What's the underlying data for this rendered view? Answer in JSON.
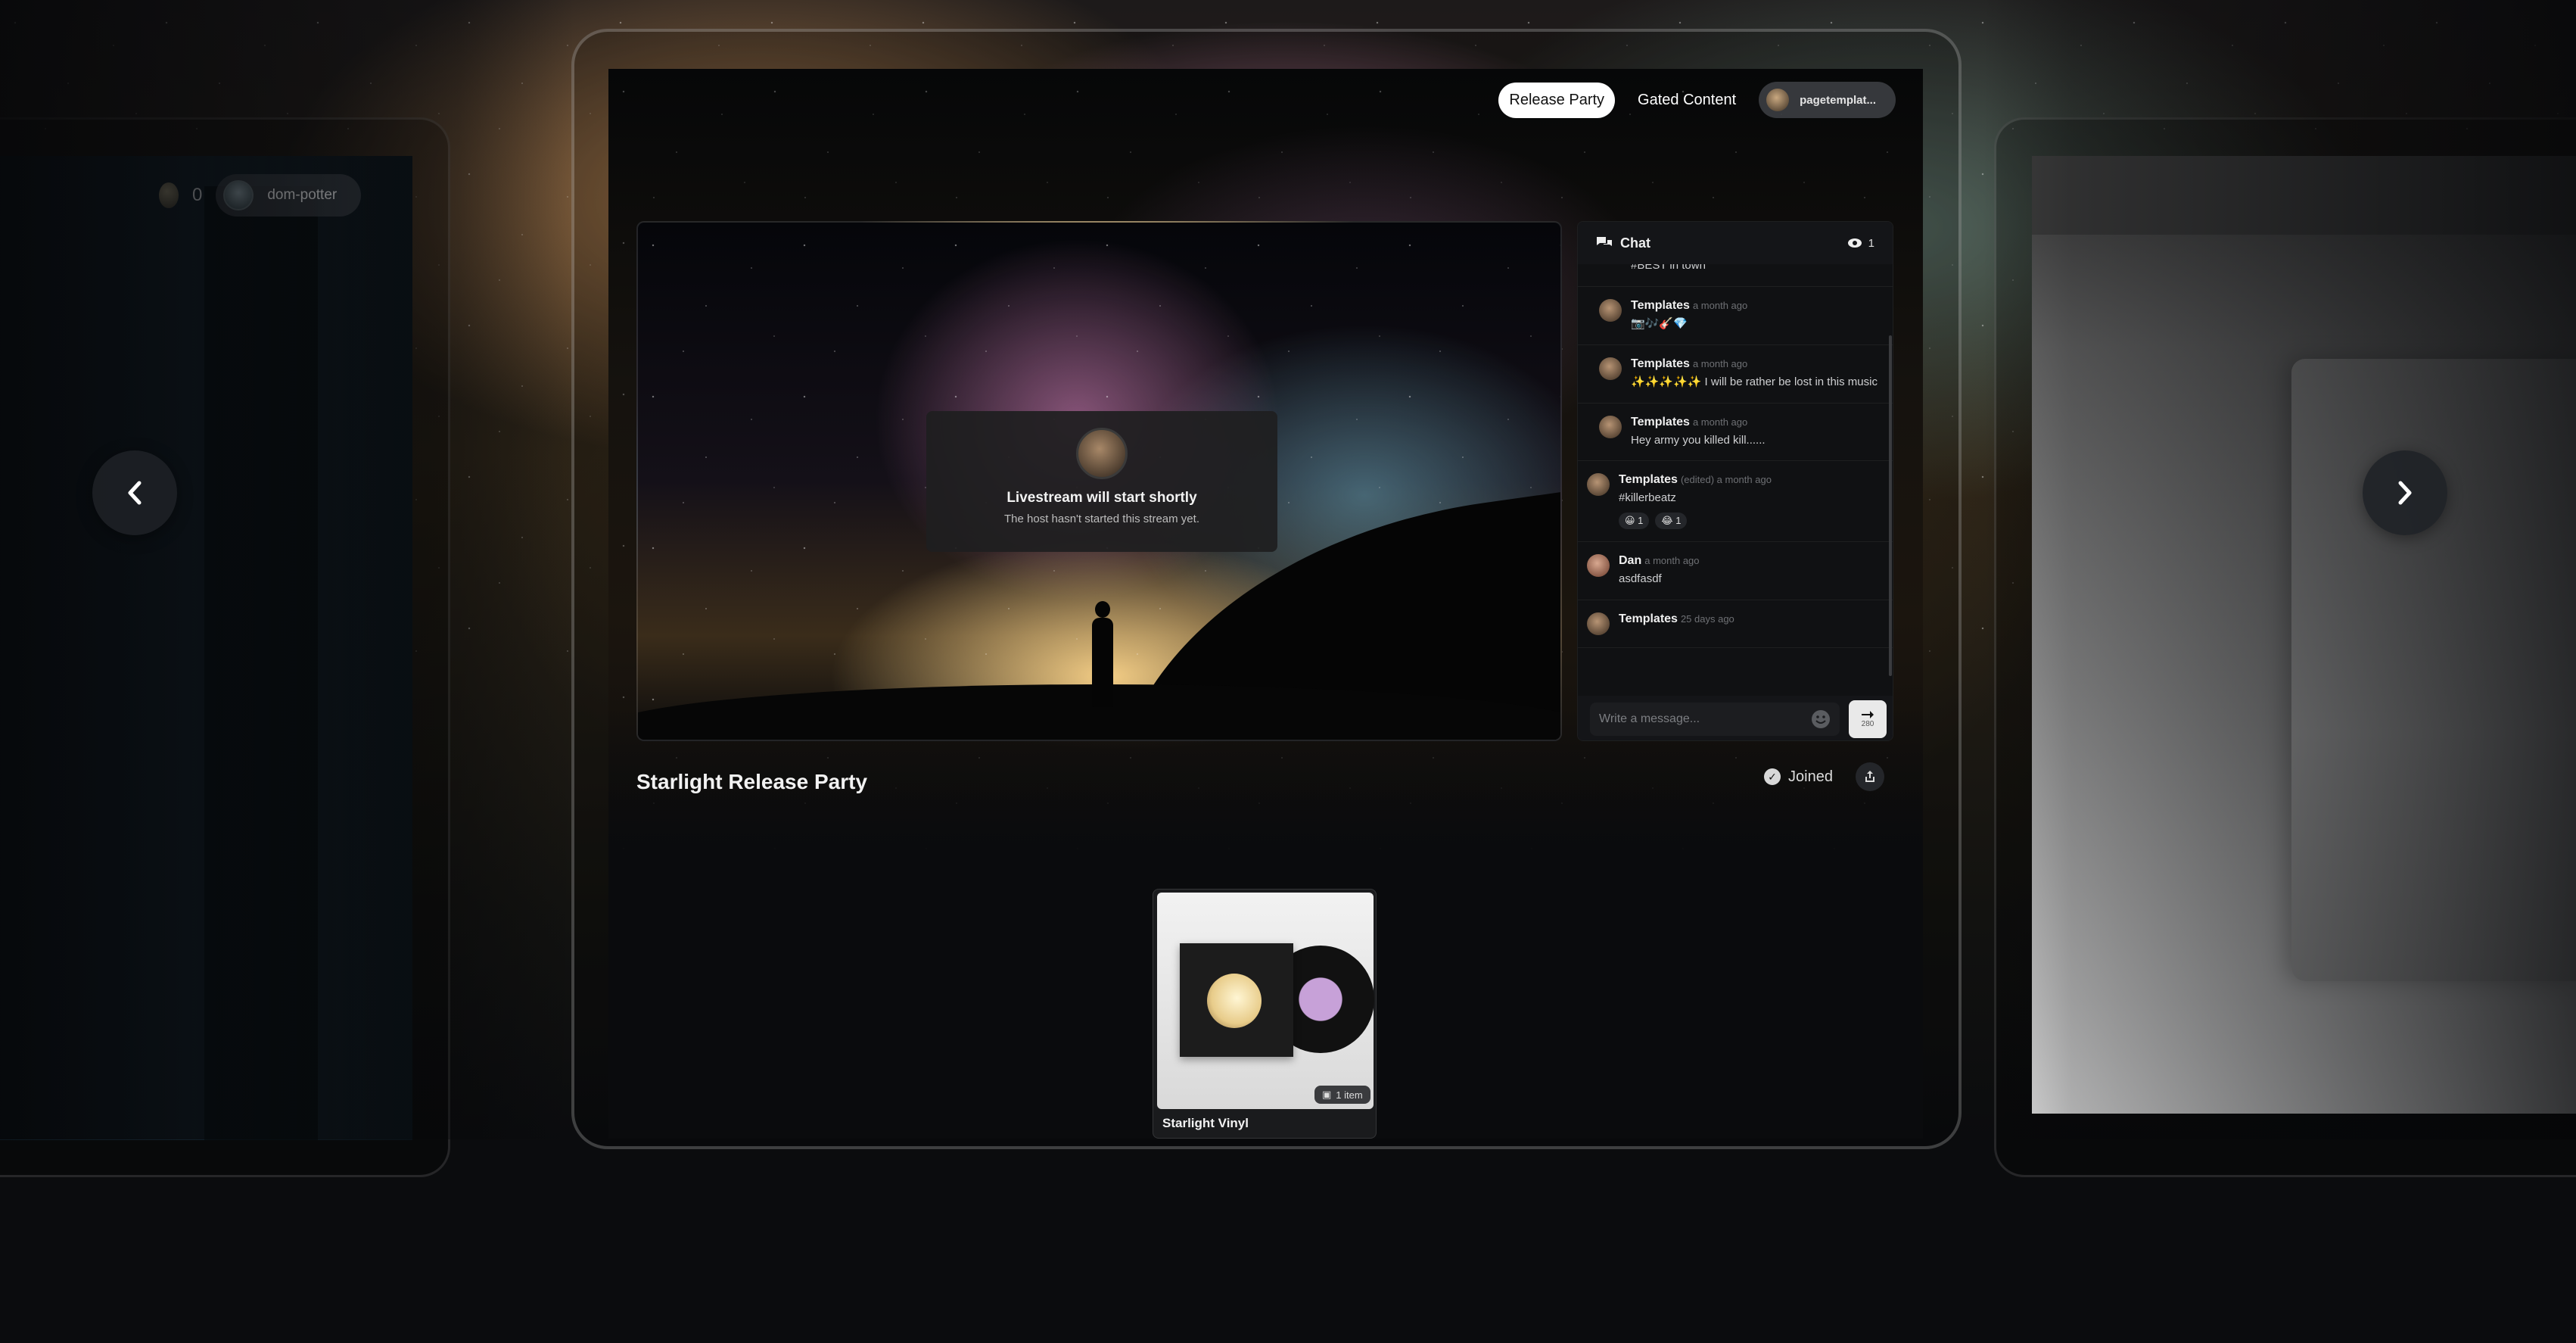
{
  "left_preview": {
    "coin_count": "0",
    "username": "dom-potter"
  },
  "nav": {
    "prev_icon": "chevron-left-icon",
    "next_icon": "chevron-right-icon"
  },
  "topnav": {
    "tabs": [
      {
        "label": "Release Party",
        "active": true
      },
      {
        "label": "Gated Content",
        "active": false
      }
    ],
    "account": "pagetemplat..."
  },
  "stream": {
    "title": "Livestream will start shortly",
    "subtitle": "The host hasn't started this stream yet."
  },
  "chat": {
    "title": "Chat",
    "viewer_count": "1",
    "messages": [
      {
        "author": "",
        "time": "",
        "text": "#BEST in town"
      },
      {
        "author": "Templates",
        "time": "a month ago",
        "text": "📷🎶🎸💎"
      },
      {
        "author": "Templates",
        "time": "a month ago",
        "text": "✨✨✨✨✨ I will be rather be lost in this music"
      },
      {
        "author": "Templates",
        "time": "a month ago",
        "text": "Hey army you killed kill......"
      },
      {
        "author": "Templates",
        "time": "(edited) a month ago",
        "text": "#killerbeatz",
        "reactions": [
          "😀 1",
          "😂 1"
        ]
      },
      {
        "author": "Dan",
        "time": "a month ago",
        "text": "asdfasdf"
      },
      {
        "author": "Templates",
        "time": "25 days ago",
        "text": ""
      }
    ],
    "input_placeholder": "Write a message...",
    "char_limit": "280"
  },
  "event": {
    "title": "Starlight Release Party",
    "joined_label": "Joined"
  },
  "product": {
    "name": "Starlight Vinyl",
    "badge": "1 item"
  },
  "colors": {
    "background": "#0b0c0e",
    "active_tab_bg": "#ffffff",
    "chat_bg": "#101113"
  }
}
